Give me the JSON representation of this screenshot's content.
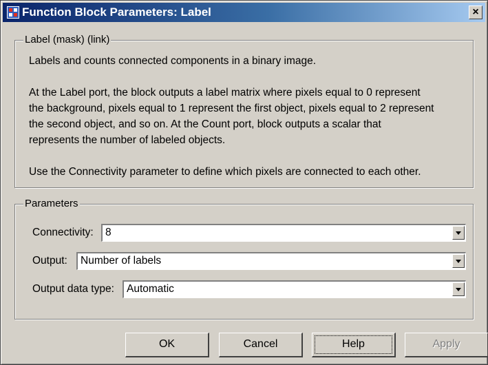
{
  "window": {
    "title": "Function Block Parameters: Label",
    "close_label": "×"
  },
  "description": {
    "legend": "Label (mask) (link)",
    "lines": [
      "Labels and counts connected components in a binary image.",
      "At the Label port, the block outputs a label matrix where pixels equal to 0 represent",
      "the background, pixels equal to 1 represent the first object, pixels equal to 2 represent",
      "the second object, and so on.  At the Count port, block outputs a scalar that",
      "represents the number of labeled objects.",
      "Use the Connectivity parameter to define which pixels are connected to each other."
    ]
  },
  "parameters": {
    "legend": "Parameters",
    "fields": [
      {
        "label": "Connectivity:",
        "value": "8"
      },
      {
        "label": "Output:",
        "value": "Number of labels"
      },
      {
        "label": "Output data type:",
        "value": "Automatic"
      }
    ]
  },
  "buttons": {
    "ok": "OK",
    "cancel": "Cancel",
    "help": "Help",
    "apply": "Apply"
  },
  "colors": {
    "title_gradient_start": "#0a246a",
    "title_gradient_end": "#a6caf0",
    "dialog_bg": "#d4d0c8"
  },
  "icons": {
    "title": "simulink-block-icon",
    "close": "close-icon",
    "dropdown": "chevron-down-icon"
  }
}
